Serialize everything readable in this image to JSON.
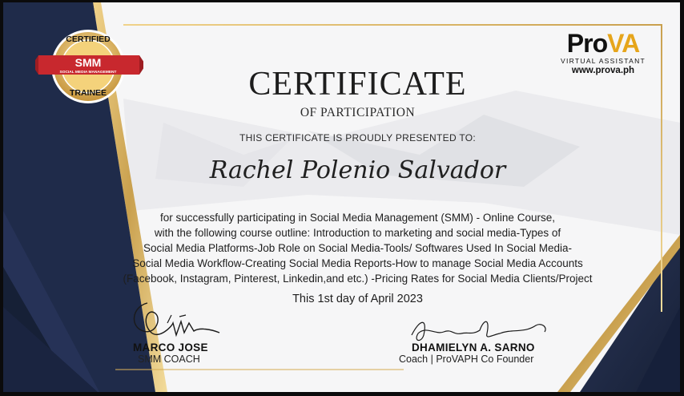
{
  "certificate": {
    "title": "CERTIFICATE",
    "subtitle": "OF PARTICIPATION",
    "presented_line": "THIS CERTIFICATE IS PROUDLY PRESENTED TO:",
    "recipient": "Rachel Polenio Salvador",
    "body_lines": [
      "for successfully participating in Social Media Management (SMM) - Online Course,",
      "with the following course outline: Introduction to marketing and social media-Types of",
      "Social Media Platforms-Job Role on Social Media-Tools/ Softwares Used In Social Media-",
      "Social Media Workflow-Creating Social Media Reports-How to manage Social Media Accounts",
      "(Facebook, Instagram, Pinterest, Linkedin,and etc.) -Pricing Rates for Social Media Clients/Project"
    ],
    "date_line": "This 1st day of April 2023"
  },
  "signatories": [
    {
      "name": "MARCO JOSE",
      "role": "SMM COACH"
    },
    {
      "name": "DHAMIELYN A. SARNO",
      "role": "Coach | ProVAPH Co Founder"
    }
  ],
  "seal": {
    "top_text": "CERTIFIED",
    "main_text": "SMM",
    "ribbon_text": "SOCIAL MEDIA MANAGEMENT",
    "bottom_text": "TRAINEE"
  },
  "brand": {
    "logo_pro": "Pro",
    "logo_va": "VA",
    "tagline": "VIRTUAL ASSISTANT",
    "url": "www.prova.ph"
  },
  "colors": {
    "navy": "#1f2b4a",
    "gold": "#d9b15a",
    "seal_red": "#c8282e",
    "brand_accent": "#e6a51b"
  }
}
